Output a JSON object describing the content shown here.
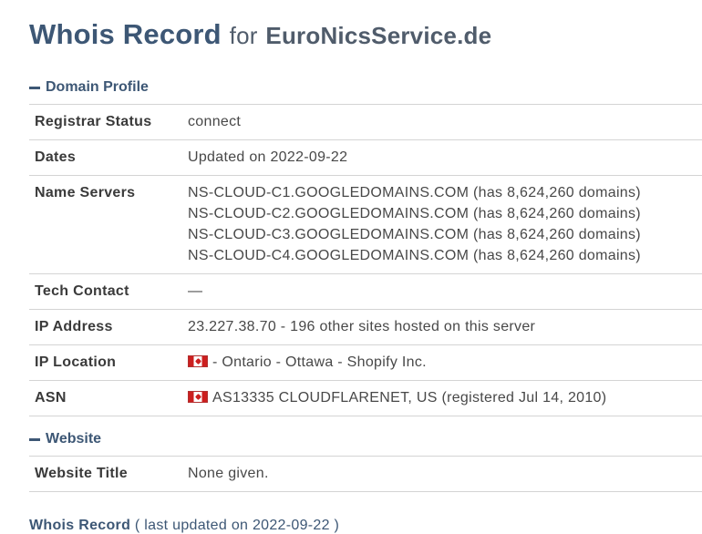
{
  "header": {
    "title_main": "Whois Record",
    "title_for": "for",
    "domain": "EuroNicsService.de"
  },
  "domain_profile": {
    "heading": "Domain Profile",
    "rows": {
      "registrar_status": {
        "label": "Registrar Status",
        "value": "connect"
      },
      "dates": {
        "label": "Dates",
        "value": "Updated on 2022-09-22"
      },
      "name_servers": {
        "label": "Name Servers",
        "values": [
          "NS-CLOUD-C1.GOOGLEDOMAINS.COM (has 8,624,260 domains)",
          "NS-CLOUD-C2.GOOGLEDOMAINS.COM (has 8,624,260 domains)",
          "NS-CLOUD-C3.GOOGLEDOMAINS.COM (has 8,624,260 domains)",
          "NS-CLOUD-C4.GOOGLEDOMAINS.COM (has 8,624,260 domains)"
        ]
      },
      "tech_contact": {
        "label": "Tech Contact",
        "value": "—"
      },
      "ip_address": {
        "label": "IP Address",
        "value": "23.227.38.70 - 196 other sites hosted on this server"
      },
      "ip_location": {
        "label": "IP Location",
        "value": "- Ontario - Ottawa - Shopify Inc.",
        "flag": "canada-flag-icon"
      },
      "asn": {
        "label": "ASN",
        "value": "AS13335 CLOUDFLARENET, US (registered Jul 14, 2010)",
        "flag": "canada-flag-icon"
      }
    }
  },
  "website": {
    "heading": "Website",
    "rows": {
      "website_title": {
        "label": "Website Title",
        "value": "None given."
      }
    }
  },
  "footer": {
    "title": "Whois Record",
    "note": "( last updated on 2022-09-22 )"
  },
  "colors": {
    "accent": "#3d5775",
    "text": "#3a3a3a",
    "border": "#d4d4d4",
    "flag_red": "#cc1f1f"
  }
}
